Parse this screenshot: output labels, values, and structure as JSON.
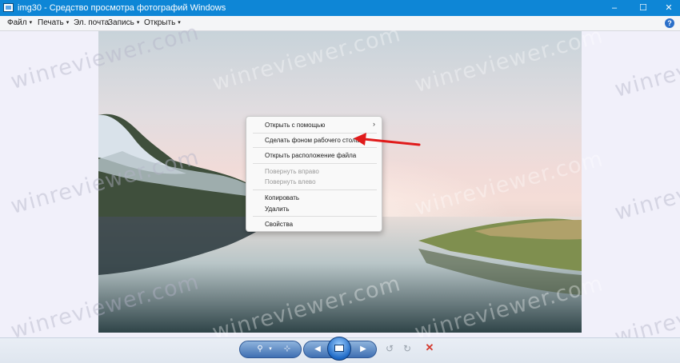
{
  "window": {
    "title": "img30 - Средство просмотра фотографий Windows",
    "minimize": "–",
    "maximize": "☐",
    "close": "✕"
  },
  "menu": {
    "items": [
      {
        "label": "Файл",
        "caret": "▾"
      },
      {
        "label": "Печать",
        "caret": "▾"
      },
      {
        "label": "Эл. почта",
        "caret": ""
      },
      {
        "label": "Запись",
        "caret": "▾"
      },
      {
        "label": "Открыть",
        "caret": "▾"
      }
    ],
    "help": "?"
  },
  "context_menu": {
    "items": [
      {
        "label": "Открыть с помощью",
        "disabled": false
      },
      {
        "label": "Сделать фоном рабочего стола",
        "disabled": false
      },
      {
        "label": "Открыть расположение файла",
        "disabled": false
      },
      {
        "label": "Повернуть вправо",
        "disabled": true
      },
      {
        "label": "Повернуть влево",
        "disabled": true
      },
      {
        "label": "Копировать",
        "disabled": false
      },
      {
        "label": "Удалить",
        "disabled": false
      },
      {
        "label": "Свойства",
        "disabled": false
      }
    ],
    "submenu_arrow": "›"
  },
  "watermark": "winreviewer.com",
  "toolbar": {
    "zoom_icon": "⚲",
    "zoom_caret": "▾",
    "fit_icon": "⊹",
    "prev_icon": "◀",
    "next_icon": "▶",
    "rotate_left_icon": "↺",
    "rotate_right_icon": "↻",
    "delete_icon": "✕"
  },
  "colors": {
    "titlebar": "#0e86d6",
    "arrow": "#e01b1b",
    "viewer_bg": "#f1f0fa"
  }
}
